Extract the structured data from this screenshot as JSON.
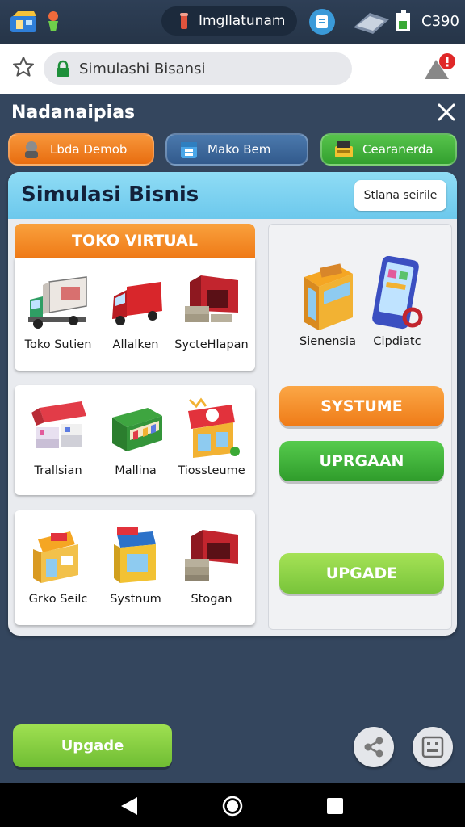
{
  "status_bar": {
    "pill_text": "Imgllatunam",
    "time": "C390",
    "icons": [
      "game-app-icon",
      "notification-icon",
      "app-badge-icon",
      "signal-icon",
      "battery-icon"
    ]
  },
  "browser": {
    "url": "Simulashi Bisansi",
    "icons": [
      "star-icon",
      "lock-icon",
      "alert-icon"
    ]
  },
  "app": {
    "title": "Nadanaipias",
    "tabs": [
      {
        "label": "Lbda Demob",
        "color": "#f0841f"
      },
      {
        "label": "Mako Bem",
        "color": "#3c669a"
      },
      {
        "label": "Cearanerda",
        "color": "#45b23c"
      }
    ]
  },
  "panel": {
    "title": "Simulasi Bisnis",
    "header_button": "Stlana seirile",
    "section_title": "TOKO VIRTUAL",
    "grid": [
      [
        {
          "label": "Toko Sutien",
          "icon": "truck-icon"
        },
        {
          "label": "Allalken",
          "icon": "van-icon"
        },
        {
          "label": "SycteHlapan",
          "icon": "warehouse-icon"
        }
      ],
      [
        {
          "label": "Trallsian",
          "icon": "market-stall-icon"
        },
        {
          "label": "Mallina",
          "icon": "kiosk-icon"
        },
        {
          "label": "Tiossteume",
          "icon": "shop-icon"
        }
      ],
      [
        {
          "label": "Grko Seilc",
          "icon": "store-icon"
        },
        {
          "label": "Systnum",
          "icon": "booth-icon"
        },
        {
          "label": "Stogan",
          "icon": "storage-icon"
        }
      ]
    ],
    "right": {
      "items": [
        {
          "label": "Sienensia",
          "icon": "storefront-icon"
        },
        {
          "label": "Cipdiatc",
          "icon": "phone-icon"
        }
      ],
      "buttons": [
        "SYSTUME",
        "UPRGAAN",
        "UPGADE"
      ]
    }
  },
  "bottom": {
    "upgrade_label": "Upgade"
  },
  "colors": {
    "background": "#34465e",
    "orange": "#f0841f",
    "green": "#3aa935",
    "lime": "#8fd348",
    "panel_header": "#7dd2f0"
  }
}
